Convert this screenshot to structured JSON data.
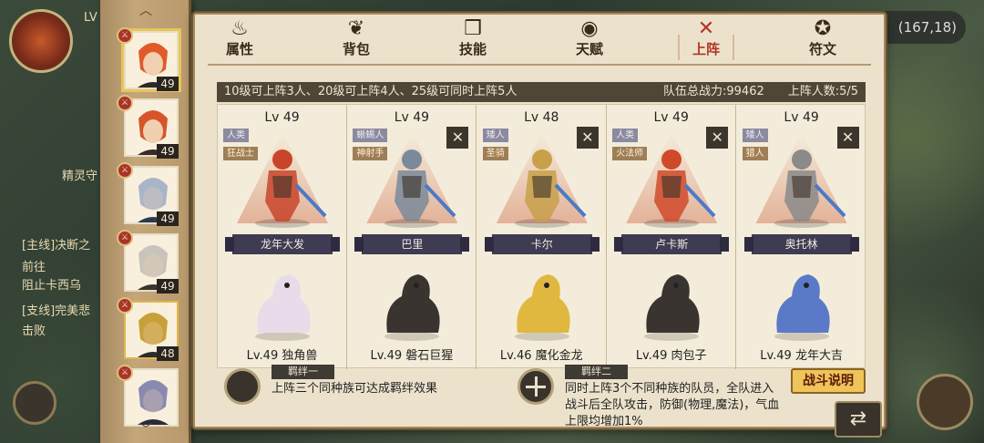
{
  "hud": {
    "coord": "(167,18)",
    "left_texts": [
      "精灵守",
      "[主线]决断之",
      "前往",
      "阻止卡西乌",
      "[支线]完美悲",
      "击败"
    ],
    "lvl_prefix": "LV"
  },
  "tabs": [
    {
      "label": "属性",
      "icon": "flame-icon",
      "glyph": "♨"
    },
    {
      "label": "背包",
      "icon": "bag-icon",
      "glyph": "❦"
    },
    {
      "label": "技能",
      "icon": "book-icon",
      "glyph": "❒"
    },
    {
      "label": "天赋",
      "icon": "eye-icon",
      "glyph": "◉"
    },
    {
      "label": "上阵",
      "icon": "crossed-swords-icon",
      "glyph": "✕"
    },
    {
      "label": "符文",
      "icon": "rune-icon",
      "glyph": "✪"
    }
  ],
  "active_tab": "上阵",
  "side_heroes": [
    {
      "level": "49",
      "colors": [
        "#e05a2a",
        "#2a2a2a"
      ]
    },
    {
      "level": "49",
      "colors": [
        "#d8552c",
        "#3a2a2a"
      ]
    },
    {
      "level": "49",
      "colors": [
        "#a8b4c8",
        "#2a3a50"
      ]
    },
    {
      "level": "49",
      "colors": [
        "#c8c4bc",
        "#3a3430"
      ]
    },
    {
      "level": "48",
      "colors": [
        "#c8a03a",
        "#2a2a30"
      ]
    },
    {
      "level": "",
      "colors": [
        "#8a8ab0",
        "#2a2a40"
      ]
    }
  ],
  "info": {
    "rules": "10级可上阵3人、20级可上阵4人、25级可同时上阵5人",
    "power": "队伍总战力:99462",
    "count": "上阵人数:5/5"
  },
  "team": [
    {
      "lv": "Lv 49",
      "race": "人类",
      "cls": "狂战士",
      "name": "龙年大发",
      "removable": false,
      "pet": "Lv.49 独角兽",
      "hero_color": "#c8452a",
      "pet_color": "#e8dcea"
    },
    {
      "lv": "Lv 49",
      "race": "蜥蜴人",
      "cls": "神射手",
      "name": "巴里",
      "removable": true,
      "pet": "Lv.49 磐石巨猩",
      "hero_color": "#7a8a9a",
      "pet_color": "#3a3430"
    },
    {
      "lv": "Lv 48",
      "race": "矮人",
      "cls": "圣骑",
      "name": "卡尔",
      "removable": true,
      "pet": "Lv.46 魔化金龙",
      "hero_color": "#c8a04a",
      "pet_color": "#e0b840"
    },
    {
      "lv": "Lv 49",
      "race": "人类",
      "cls": "火法师",
      "name": "卢卡斯",
      "removable": true,
      "pet": "Lv.49 肉包子",
      "hero_color": "#d04a2a",
      "pet_color": "#3a3430"
    },
    {
      "lv": "Lv 49",
      "race": "矮人",
      "cls": "猎人",
      "name": "奥托林",
      "removable": true,
      "pet": "Lv.49 龙年大吉",
      "hero_color": "#8a8a8a",
      "pet_color": "#5a7ac8"
    }
  ],
  "bonds": [
    {
      "title": "羁绊一",
      "desc": "上阵三个同种族可达成羁绊效果"
    },
    {
      "title": "羁绊二",
      "desc_lines": [
        "同时上阵3个不同种族的队员，全队进入",
        "战斗后全队攻击，防御(物理,魔法)，气血",
        "上限均增加1%"
      ]
    }
  ],
  "buttons": {
    "fight_help": "战斗说明",
    "return_glyph": "⇄",
    "remove_glyph": "✕",
    "up": "︿",
    "down": "﹀"
  }
}
